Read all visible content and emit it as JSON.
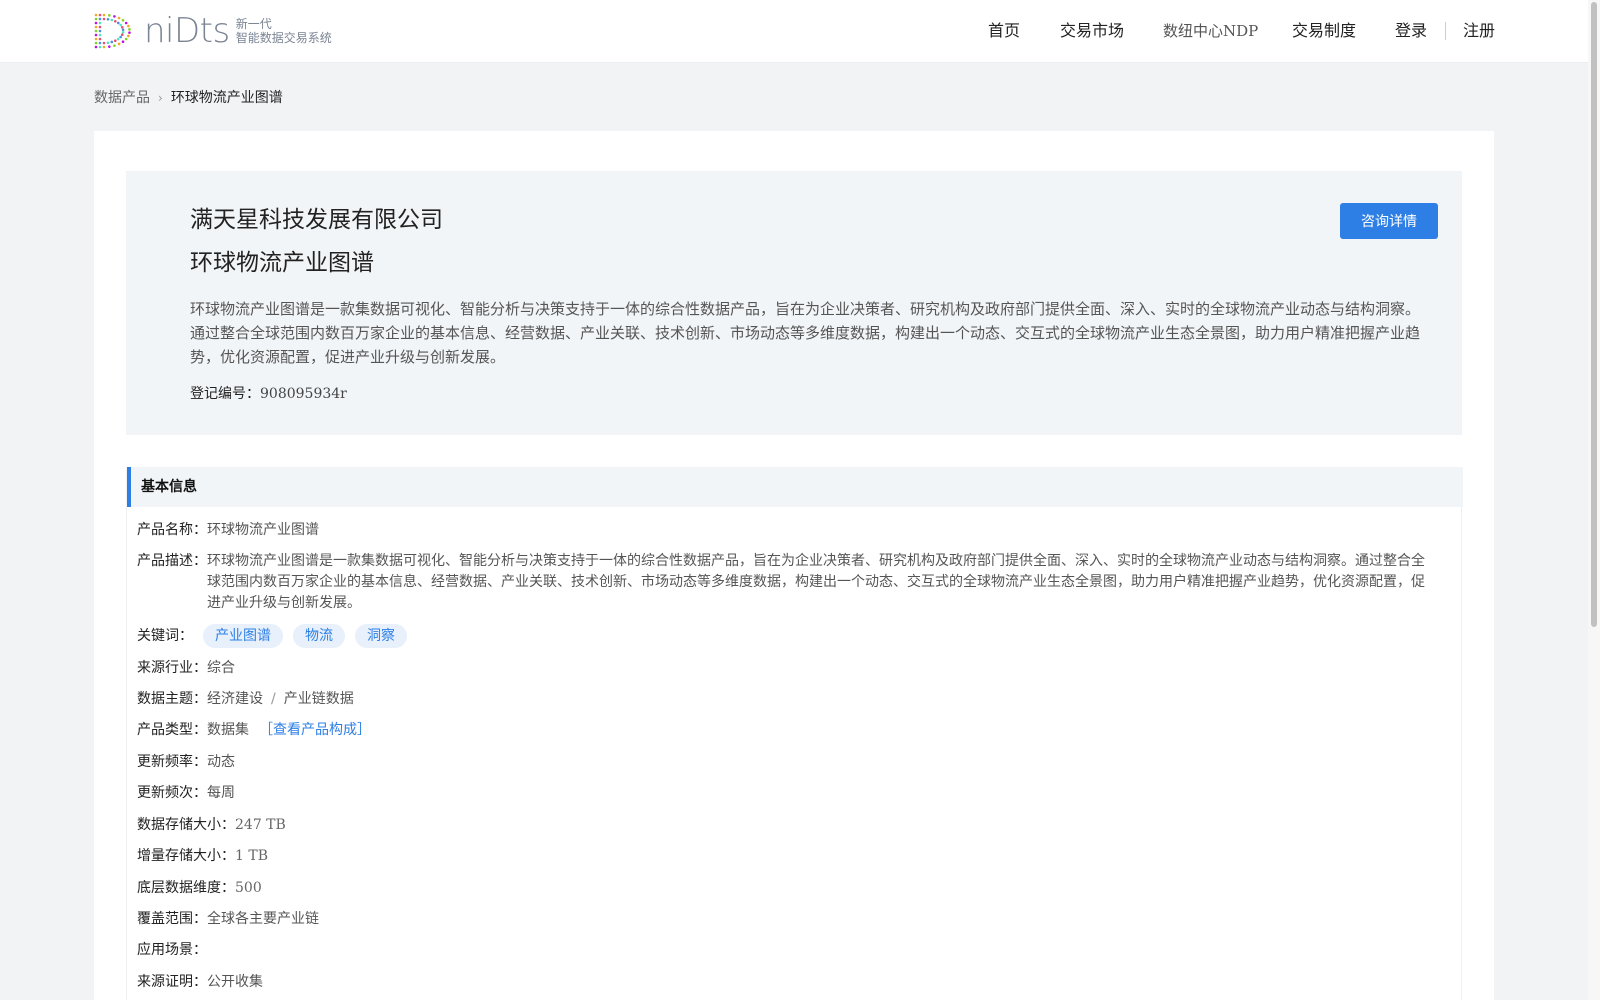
{
  "header": {
    "logo_word": "niDts",
    "logo_tagline_1": "新一代",
    "logo_tagline_2": "智能数据交易系统",
    "nav": [
      {
        "label": "首页"
      },
      {
        "label": "交易市场"
      },
      {
        "label": "数纽中心NDP"
      },
      {
        "label": "交易制度"
      },
      {
        "label": "登录"
      },
      {
        "label": "注册"
      }
    ]
  },
  "breadcrumb": {
    "parent": "数据产品",
    "current": "环球物流产业图谱"
  },
  "hero": {
    "company": "满天星科技发展有限公司",
    "title": "环球物流产业图谱",
    "description": "环球物流产业图谱是一款集数据可视化、智能分析与决策支持于一体的综合性数据产品，旨在为企业决策者、研究机构及政府部门提供全面、深入、实时的全球物流产业动态与结构洞察。通过整合全球范围内数百万家企业的基本信息、经营数据、产业关联、技术创新、市场动态等多维度数据，构建出一个动态、交互式的全球物流产业生态全景图，助力用户精准把握产业趋势，优化资源配置，促进产业升级与创新发展。",
    "reg_label": "登记编号：",
    "reg_value": "908095934r",
    "consult_button": "咨询详情"
  },
  "basic_info": {
    "title": "基本信息",
    "product_name_label": "产品名称：",
    "product_name": "环球物流产业图谱",
    "product_desc_label": "产品描述：",
    "product_desc": "环球物流产业图谱是一款集数据可视化、智能分析与决策支持于一体的综合性数据产品，旨在为企业决策者、研究机构及政府部门提供全面、深入、实时的全球物流产业动态与结构洞察。通过整合全球范围内数百万家企业的基本信息、经营数据、产业关联、技术创新、市场动态等多维度数据，构建出一个动态、交互式的全球物流产业生态全景图，助力用户精准把握产业趋势，优化资源配置，促进产业升级与创新发展。",
    "keywords_label": "关键词：",
    "keywords": [
      "产业图谱",
      "物流",
      "洞察"
    ],
    "industry_label": "来源行业：",
    "industry": "综合",
    "theme_label": "数据主题：",
    "theme_1": "经济建设",
    "theme_sep": "/",
    "theme_2": "产业链数据",
    "type_label": "产品类型：",
    "type": "数据集",
    "type_link": "［查看产品构成］",
    "update_rate_label": "更新频率：",
    "update_rate": "动态",
    "update_freq_label": "更新频次：",
    "update_freq": "每周",
    "storage_label": "数据存储大小：",
    "storage": "247 TB",
    "increment_label": "增量存储大小：",
    "increment": "1 TB",
    "dimension_label": "底层数据维度：",
    "dimension": "500",
    "coverage_label": "覆盖范围：",
    "coverage": "全球各主要产业链",
    "scenario_label": "应用场景：",
    "scenario": "",
    "source_label": "来源证明：",
    "source": "公开收集"
  }
}
